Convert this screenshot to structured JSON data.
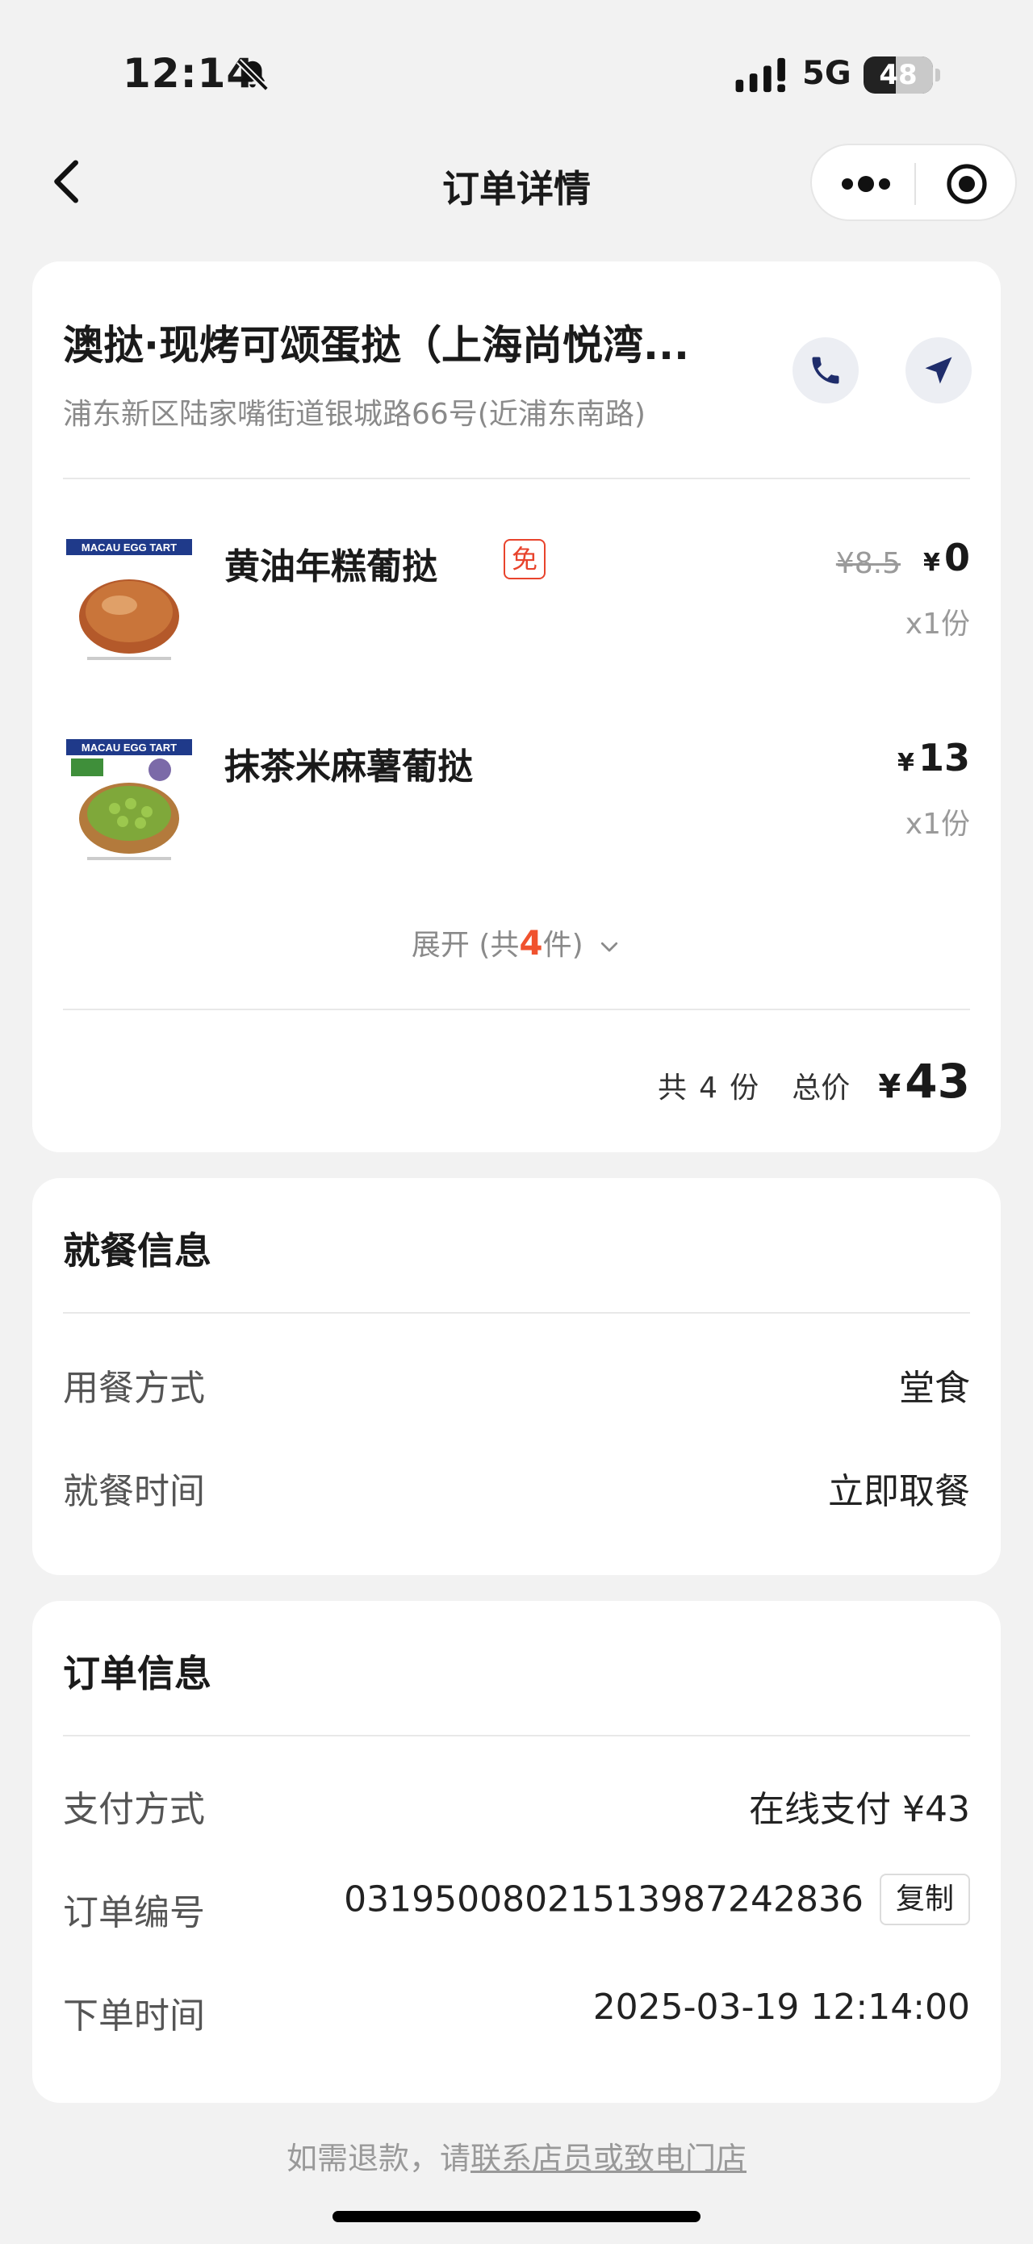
{
  "status_bar": {
    "time": "12:14",
    "network": "5G",
    "battery": "48"
  },
  "nav": {
    "title": "订单详情"
  },
  "store": {
    "name": "澳挞·现烤可颂蛋挞（上海尚悦湾...",
    "address": "浦东新区陆家嘴街道银城路66号(近浦东南路)"
  },
  "items": [
    {
      "name": "黄油年糕葡挞",
      "tag": "免",
      "original_price": "¥8.5",
      "currency": "¥",
      "price": "0",
      "qty": "x1份",
      "image_text": "MACAU EGG TART",
      "image_icon": "butter-egg-tart-image"
    },
    {
      "name": "抹茶米麻薯葡挞",
      "currency": "¥",
      "price": "13",
      "qty": "x1份",
      "image_text": "MACAU EGG TART",
      "image_icon": "matcha-egg-tart-image"
    }
  ],
  "expand": {
    "prefix": "展开 (共",
    "count": "4",
    "suffix": "件)"
  },
  "summary": {
    "count_prefix": "共",
    "count": "4",
    "count_suffix": "份",
    "total_label": "总价",
    "currency": "¥",
    "total": "43"
  },
  "dining": {
    "title": "就餐信息",
    "rows": [
      {
        "label": "用餐方式",
        "value": "堂食"
      },
      {
        "label": "就餐时间",
        "value": "立即取餐"
      }
    ]
  },
  "order": {
    "title": "订单信息",
    "payment_label": "支付方式",
    "payment_value": "在线支付 ¥43",
    "number_label": "订单编号",
    "number_value": "03195008021513987242836",
    "copy_label": "复制",
    "time_label": "下单时间",
    "time_value": "2025-03-19 12:14:00"
  },
  "footer": {
    "prefix": "如需退款，请",
    "link": "联系店员或致电门店"
  },
  "colors": {
    "accent": "#f0522e",
    "free_tag": "#e8432c",
    "icon_blue": "#1f2d6b",
    "background": "#f2f2f2"
  }
}
